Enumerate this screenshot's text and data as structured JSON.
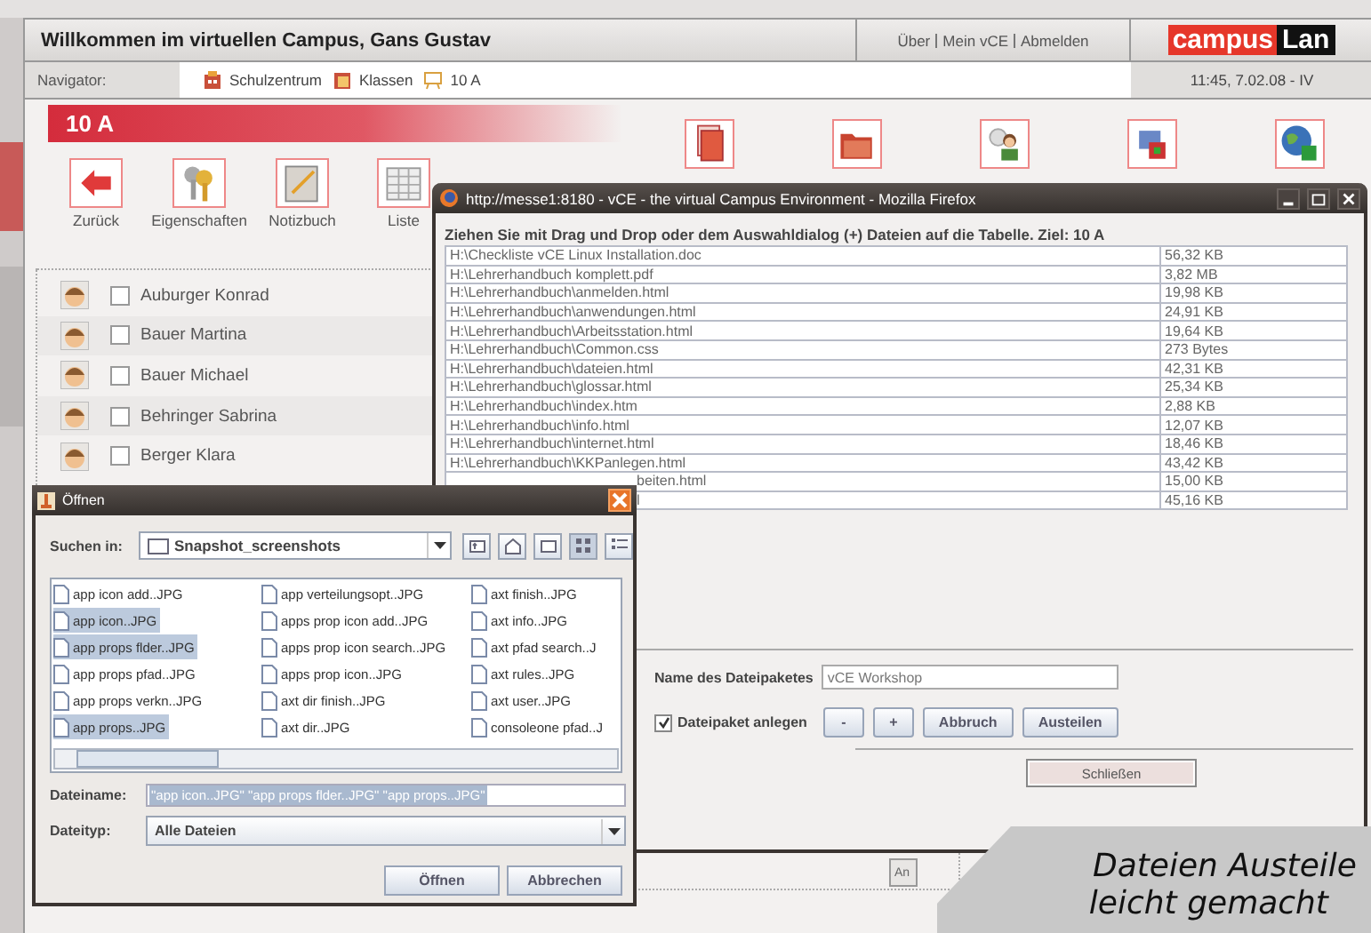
{
  "header": {
    "title": "Willkommen im virtuellen Campus, Gans Gustav",
    "links": [
      "Über",
      "Mein vCE",
      "Abmelden"
    ],
    "logo": [
      "campus",
      "Lan"
    ]
  },
  "navigator": {
    "label": "Navigator:",
    "crumbs": [
      "Schulzentrum",
      "Klassen",
      "10 A"
    ],
    "clock": "11:45, 7.02.08 - IV"
  },
  "banner": "10 A",
  "toolbar": [
    "Zurück",
    "Eigenschaften",
    "Notizbuch",
    "Liste"
  ],
  "students": [
    {
      "name": "Auburger Konrad",
      "checked": false
    },
    {
      "name": "Bauer Martina",
      "checked": false
    },
    {
      "name": "Bauer Michael",
      "checked": false
    },
    {
      "name": "Behringer Sabrina",
      "checked": false
    },
    {
      "name": "Berger Klara",
      "checked": false
    }
  ],
  "behind_button": "An",
  "firefox": {
    "title": "http://messe1:8180 - vCE - the virtual Campus Environment - Mozilla Firefox",
    "instruction": "Ziehen Sie mit Drag und Drop oder dem Auswahldialog (+) Dateien auf die Tabelle. Ziel: 10 A",
    "files": [
      {
        "path": "H:\\Checkliste vCE Linux Installation.doc",
        "size": "56,32 KB"
      },
      {
        "path": "H:\\Lehrerhandbuch komplett.pdf",
        "size": "3,82 MB"
      },
      {
        "path": "H:\\Lehrerhandbuch\\anmelden.html",
        "size": "19,98 KB"
      },
      {
        "path": "H:\\Lehrerhandbuch\\anwendungen.html",
        "size": "24,91 KB"
      },
      {
        "path": "H:\\Lehrerhandbuch\\Arbeitsstation.html",
        "size": "19,64 KB"
      },
      {
        "path": "H:\\Lehrerhandbuch\\Common.css",
        "size": "273 Bytes"
      },
      {
        "path": "H:\\Lehrerhandbuch\\dateien.html",
        "size": "42,31 KB"
      },
      {
        "path": "H:\\Lehrerhandbuch\\glossar.html",
        "size": "25,34 KB"
      },
      {
        "path": "H:\\Lehrerhandbuch\\index.htm",
        "size": "2,88 KB"
      },
      {
        "path": "H:\\Lehrerhandbuch\\info.html",
        "size": "12,07 KB"
      },
      {
        "path": "H:\\Lehrerhandbuch\\internet.html",
        "size": "18,46 KB"
      },
      {
        "path": "H:\\Lehrerhandbuch\\KKPanlegen.html",
        "size": "43,42 KB"
      },
      {
        "path": "beiten.html",
        "size": "15,00 KB",
        "kind": "covered"
      },
      {
        "path": "l",
        "size": "45,16 KB",
        "kind": "covered"
      }
    ],
    "package_label": "Name des Dateipaketes",
    "package_name": "vCE Workshop",
    "create_package": {
      "label": "Dateipaket anlegen",
      "checked": true
    },
    "buttons": [
      "-",
      "+",
      "Abbruch",
      "Austeilen"
    ],
    "close_button": "Schließen"
  },
  "open_dialog": {
    "title": "Öffnen",
    "look_in_label": "Suchen in:",
    "folder": "Snapshot_screenshots",
    "files": [
      {
        "name": "app icon add..JPG",
        "selected": false
      },
      {
        "name": "app icon..JPG",
        "selected": true
      },
      {
        "name": "app props flder..JPG",
        "selected": true
      },
      {
        "name": "app props pfad..JPG",
        "selected": false
      },
      {
        "name": "app props verkn..JPG",
        "selected": false
      },
      {
        "name": "app props..JPG",
        "selected": true
      },
      {
        "name": "app verteilungsopt..JPG",
        "selected": false
      },
      {
        "name": "apps prop icon add..JPG",
        "selected": false
      },
      {
        "name": "apps prop icon search..JPG",
        "selected": false
      },
      {
        "name": "apps prop icon..JPG",
        "selected": false
      },
      {
        "name": "axt dir finish..JPG",
        "selected": false
      },
      {
        "name": "axt dir..JPG",
        "selected": false
      },
      {
        "name": "axt finish..JPG",
        "selected": false
      },
      {
        "name": "axt info..JPG",
        "selected": false
      },
      {
        "name": "axt pfad search..J",
        "selected": false
      },
      {
        "name": "axt rules..JPG",
        "selected": false
      },
      {
        "name": "axt user..JPG",
        "selected": false
      },
      {
        "name": "consoleone pfad..J",
        "selected": false
      }
    ],
    "filename_label": "Dateiname:",
    "filename": "\"app icon..JPG\" \"app props flder..JPG\" \"app props..JPG\"",
    "filetype_label": "Dateityp:",
    "filetype": "Alle Dateien",
    "buttons": [
      "Öffnen",
      "Abbrechen"
    ]
  },
  "callout": [
    "Dateien Austeile",
    "leicht gemacht"
  ]
}
